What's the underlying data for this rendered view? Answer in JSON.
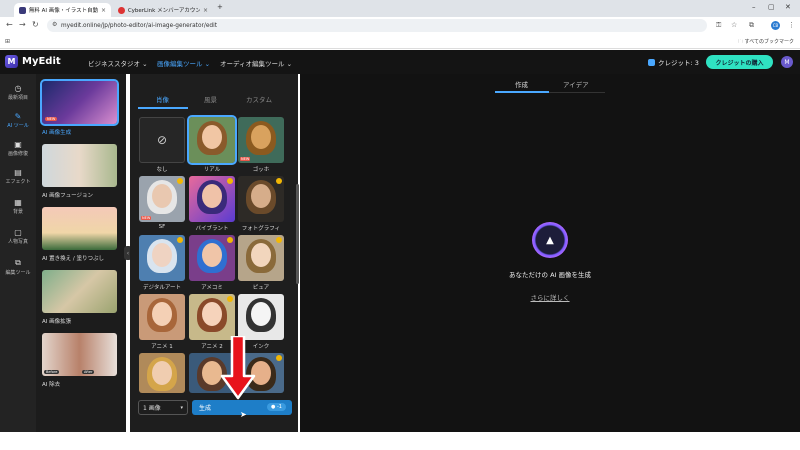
{
  "browser": {
    "tabs": [
      {
        "title": "無料 AI 画像・イラスト自動生成！..."
      },
      {
        "title": "CyberLink メンバーアカウント設定..."
      }
    ],
    "new_tab": "+",
    "url": "myedit.online/jp/photo-editor/ai-image-generator/edit",
    "bookmarks_all": "すべてのブックマーク",
    "profile": "CB"
  },
  "header": {
    "logo_text": "MyEdit",
    "nav": [
      {
        "label": "ビジネススタジオ ⌄"
      },
      {
        "label": "画像編集ツール ⌄"
      },
      {
        "label": "オーディオ編集ツール ⌄"
      }
    ],
    "credit": "クレジット: 3",
    "buy_button": "クレジットの購入",
    "user_initial": "M"
  },
  "rail": [
    {
      "icon": "history-icon",
      "label": "最新項目"
    },
    {
      "icon": "ai-tools-icon",
      "label": "AI ツール"
    },
    {
      "icon": "image-edit-icon",
      "label": "画像修復"
    },
    {
      "icon": "effect-icon",
      "label": "エフェクト"
    },
    {
      "icon": "background-icon",
      "label": "背景"
    },
    {
      "icon": "portrait-icon",
      "label": "人物写真"
    },
    {
      "icon": "edit-tools-icon",
      "label": "編集ツール"
    }
  ],
  "tools": [
    {
      "label": "AI 画像生成"
    },
    {
      "label": "AI 画像フュージョン"
    },
    {
      "label": "AI 置き換え / 塗りつぶし"
    },
    {
      "label": "AI 画像拡張"
    },
    {
      "label": "AI 除去"
    }
  ],
  "panel": {
    "tabs": [
      "肖像",
      "風景",
      "カスタム"
    ],
    "styles": [
      {
        "label": "なし"
      },
      {
        "label": "リアル"
      },
      {
        "label": "ゴッホ"
      },
      {
        "label": "SF"
      },
      {
        "label": "バイブラント"
      },
      {
        "label": "フォトグラフィ"
      },
      {
        "label": "デジタルアート"
      },
      {
        "label": "アメコミ"
      },
      {
        "label": "ピュア"
      },
      {
        "label": "アニメ 1"
      },
      {
        "label": "アニメ 2"
      },
      {
        "label": "インク"
      }
    ],
    "none_symbol": "⊘",
    "count_select": "1 画像",
    "generate_label": "生成",
    "generate_cost": "-1"
  },
  "main": {
    "tabs": [
      "作成",
      "アイデア"
    ],
    "empty_text": "あなただけの AI 画像を生成",
    "learn_more": "さらに詳しく"
  }
}
